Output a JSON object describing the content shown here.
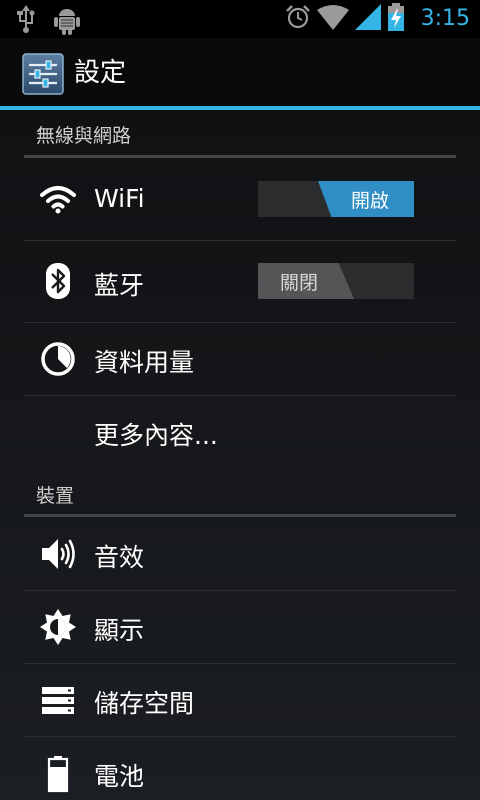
{
  "status_bar": {
    "time": "3:15",
    "icons": [
      "usb-icon",
      "android-debug-icon",
      "alarm-icon",
      "wifi-signal-icon",
      "cell-signal-icon",
      "battery-charging-icon"
    ]
  },
  "action_bar": {
    "title": "設定",
    "app_icon": "settings-sliders-icon"
  },
  "sections": {
    "wireless": {
      "header": "無線與網路",
      "items": {
        "wifi": {
          "label": "WiFi",
          "icon": "wifi-icon",
          "toggle": "開啟",
          "state": "on"
        },
        "bluetooth": {
          "label": "藍牙",
          "icon": "bluetooth-icon",
          "toggle": "關閉",
          "state": "off"
        },
        "data_usage": {
          "label": "資料用量",
          "icon": "data-usage-icon"
        },
        "more": {
          "label": "更多內容..."
        }
      }
    },
    "device": {
      "header": "裝置",
      "items": {
        "sound": {
          "label": "音效",
          "icon": "speaker-icon"
        },
        "display": {
          "label": "顯示",
          "icon": "brightness-icon"
        },
        "storage": {
          "label": "儲存空間",
          "icon": "storage-icon"
        },
        "battery": {
          "label": "電池",
          "icon": "battery-icon"
        }
      }
    }
  },
  "colors": {
    "accent": "#33b5e5",
    "toggle_on": "#2f8ec4",
    "toggle_off": "#535557"
  }
}
